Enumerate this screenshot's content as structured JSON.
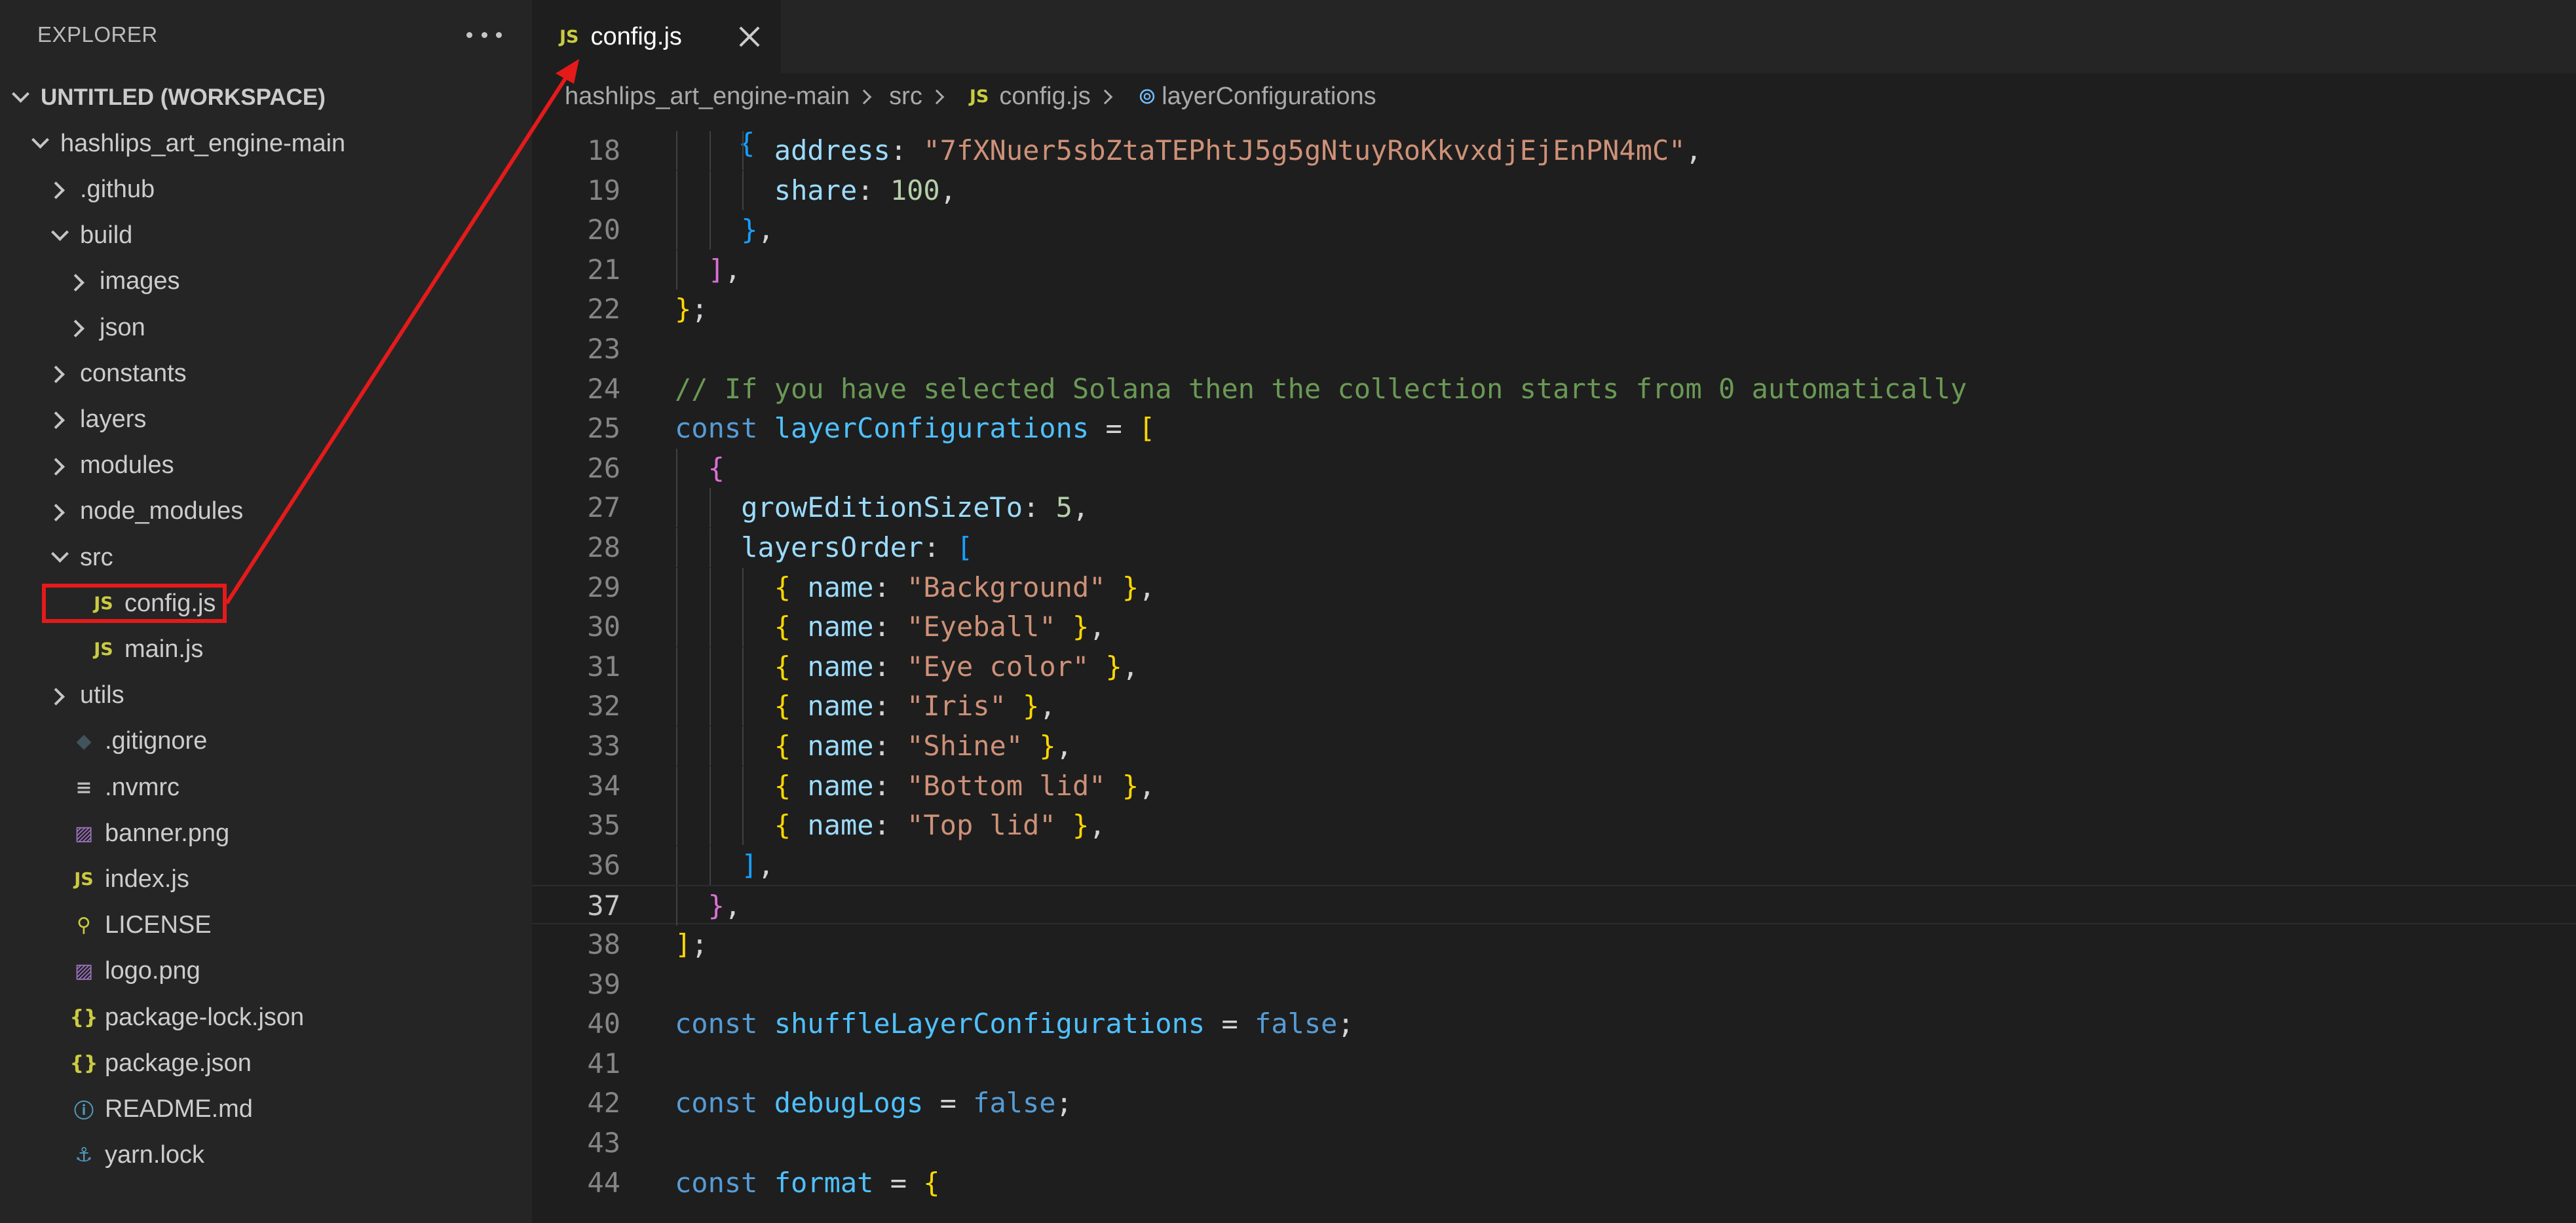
{
  "explorer": {
    "title": "EXPLORER",
    "more_icon": "ellipsis-icon"
  },
  "tree": [
    {
      "label": "UNTITLED (WORKSPACE)",
      "kind": "folder-open",
      "depth": 0,
      "bold": true
    },
    {
      "label": "hashlips_art_engine-main",
      "kind": "folder-open",
      "depth": 1
    },
    {
      "label": ".github",
      "kind": "folder",
      "depth": 2
    },
    {
      "label": "build",
      "kind": "folder-open",
      "depth": 2
    },
    {
      "label": "images",
      "kind": "folder",
      "depth": 3
    },
    {
      "label": "json",
      "kind": "folder",
      "depth": 3
    },
    {
      "label": "constants",
      "kind": "folder",
      "depth": 2
    },
    {
      "label": "layers",
      "kind": "folder",
      "depth": 2
    },
    {
      "label": "modules",
      "kind": "folder",
      "depth": 2
    },
    {
      "label": "node_modules",
      "kind": "folder",
      "depth": 2
    },
    {
      "label": "src",
      "kind": "folder-open",
      "depth": 2
    },
    {
      "label": "config.js",
      "kind": "js",
      "depth": 3,
      "icon_text": "JS",
      "selected": true
    },
    {
      "label": "main.js",
      "kind": "js",
      "depth": 3,
      "icon_text": "JS"
    },
    {
      "label": "utils",
      "kind": "folder",
      "depth": 2
    },
    {
      "label": ".gitignore",
      "kind": "git",
      "depth": 2,
      "icon_text": "◆"
    },
    {
      "label": ".nvmrc",
      "kind": "plain",
      "depth": 2,
      "icon_text": "≡"
    },
    {
      "label": "banner.png",
      "kind": "img",
      "depth": 2,
      "icon_text": "▨"
    },
    {
      "label": "index.js",
      "kind": "js",
      "depth": 2,
      "icon_text": "JS"
    },
    {
      "label": "LICENSE",
      "kind": "lic",
      "depth": 2,
      "icon_text": "⚲"
    },
    {
      "label": "logo.png",
      "kind": "img",
      "depth": 2,
      "icon_text": "▨"
    },
    {
      "label": "package-lock.json",
      "kind": "json",
      "depth": 2,
      "icon_text": "{}"
    },
    {
      "label": "package.json",
      "kind": "json",
      "depth": 2,
      "icon_text": "{}"
    },
    {
      "label": "README.md",
      "kind": "info",
      "depth": 2,
      "icon_text": "ⓘ"
    },
    {
      "label": "yarn.lock",
      "kind": "yarn",
      "depth": 2,
      "icon_text": "⚓"
    }
  ],
  "tab": {
    "badge": "JS",
    "label": "config.js"
  },
  "breadcrumb": {
    "items": [
      "hashlips_art_engine-main",
      "src",
      "config.js",
      "layerConfigurations"
    ],
    "js_badge": "JS",
    "symbol_glyph": "⊚"
  },
  "code": {
    "current_line": 37,
    "lines": [
      {
        "n": "18",
        "indent": 3,
        "tokens": [
          [
            "v",
            "address"
          ],
          [
            "p",
            ": "
          ],
          [
            "s",
            "\"7fXNuer5sbZtaTEPhtJ5g5gNtuyRoKkvxdjEjEnPN4mC\""
          ],
          [
            "p",
            ","
          ]
        ]
      },
      {
        "n": "19",
        "indent": 3,
        "tokens": [
          [
            "v",
            "share"
          ],
          [
            "p",
            ": "
          ],
          [
            "num",
            "100"
          ],
          [
            "p",
            ","
          ]
        ]
      },
      {
        "n": "20",
        "indent": 2,
        "tokens": [
          [
            "b3",
            "}"
          ],
          [
            "p",
            ","
          ]
        ]
      },
      {
        "n": "21",
        "indent": 1,
        "tokens": [
          [
            "b2",
            "]"
          ],
          [
            "p",
            ","
          ]
        ]
      },
      {
        "n": "22",
        "indent": 0,
        "tokens": [
          [
            "b1",
            "}"
          ],
          [
            "p",
            ";"
          ]
        ]
      },
      {
        "n": "23",
        "indent": 0,
        "tokens": []
      },
      {
        "n": "24",
        "indent": 0,
        "tokens": [
          [
            "c",
            "// If you have selected Solana then the collection starts from 0 automatically"
          ]
        ]
      },
      {
        "n": "25",
        "indent": 0,
        "tokens": [
          [
            "k",
            "const "
          ],
          [
            "n",
            "layerConfigurations"
          ],
          [
            "p",
            " = "
          ],
          [
            "b1",
            "["
          ]
        ]
      },
      {
        "n": "26",
        "indent": 1,
        "tokens": [
          [
            "b2",
            "{"
          ]
        ]
      },
      {
        "n": "27",
        "indent": 2,
        "tokens": [
          [
            "v",
            "growEditionSizeTo"
          ],
          [
            "p",
            ": "
          ],
          [
            "num",
            "5"
          ],
          [
            "p",
            ","
          ]
        ]
      },
      {
        "n": "28",
        "indent": 2,
        "tokens": [
          [
            "v",
            "layersOrder"
          ],
          [
            "p",
            ": "
          ],
          [
            "b3",
            "["
          ]
        ]
      },
      {
        "n": "29",
        "indent": 3,
        "tokens": [
          [
            "b1",
            "{ "
          ],
          [
            "v",
            "name"
          ],
          [
            "p",
            ": "
          ],
          [
            "s",
            "\"Background\""
          ],
          [
            "b1",
            " }"
          ],
          [
            "p",
            ","
          ]
        ]
      },
      {
        "n": "30",
        "indent": 3,
        "tokens": [
          [
            "b1",
            "{ "
          ],
          [
            "v",
            "name"
          ],
          [
            "p",
            ": "
          ],
          [
            "s",
            "\"Eyeball\""
          ],
          [
            "b1",
            " }"
          ],
          [
            "p",
            ","
          ]
        ]
      },
      {
        "n": "31",
        "indent": 3,
        "tokens": [
          [
            "b1",
            "{ "
          ],
          [
            "v",
            "name"
          ],
          [
            "p",
            ": "
          ],
          [
            "s",
            "\"Eye color\""
          ],
          [
            "b1",
            " }"
          ],
          [
            "p",
            ","
          ]
        ]
      },
      {
        "n": "32",
        "indent": 3,
        "tokens": [
          [
            "b1",
            "{ "
          ],
          [
            "v",
            "name"
          ],
          [
            "p",
            ": "
          ],
          [
            "s",
            "\"Iris\""
          ],
          [
            "b1",
            " }"
          ],
          [
            "p",
            ","
          ]
        ]
      },
      {
        "n": "33",
        "indent": 3,
        "tokens": [
          [
            "b1",
            "{ "
          ],
          [
            "v",
            "name"
          ],
          [
            "p",
            ": "
          ],
          [
            "s",
            "\"Shine\""
          ],
          [
            "b1",
            " }"
          ],
          [
            "p",
            ","
          ]
        ]
      },
      {
        "n": "34",
        "indent": 3,
        "tokens": [
          [
            "b1",
            "{ "
          ],
          [
            "v",
            "name"
          ],
          [
            "p",
            ": "
          ],
          [
            "s",
            "\"Bottom lid\""
          ],
          [
            "b1",
            " }"
          ],
          [
            "p",
            ","
          ]
        ]
      },
      {
        "n": "35",
        "indent": 3,
        "tokens": [
          [
            "b1",
            "{ "
          ],
          [
            "v",
            "name"
          ],
          [
            "p",
            ": "
          ],
          [
            "s",
            "\"Top lid\""
          ],
          [
            "b1",
            " }"
          ],
          [
            "p",
            ","
          ]
        ]
      },
      {
        "n": "36",
        "indent": 2,
        "tokens": [
          [
            "b3",
            "]"
          ],
          [
            "p",
            ","
          ]
        ]
      },
      {
        "n": "37",
        "indent": 1,
        "tokens": [
          [
            "b2",
            "}"
          ],
          [
            "p",
            ","
          ]
        ]
      },
      {
        "n": "38",
        "indent": 0,
        "tokens": [
          [
            "b1",
            "]"
          ],
          [
            "p",
            ";"
          ]
        ]
      },
      {
        "n": "39",
        "indent": 0,
        "tokens": []
      },
      {
        "n": "40",
        "indent": 0,
        "tokens": [
          [
            "k",
            "const "
          ],
          [
            "n",
            "shuffleLayerConfigurations"
          ],
          [
            "p",
            " = "
          ],
          [
            "k",
            "false"
          ],
          [
            "p",
            ";"
          ]
        ]
      },
      {
        "n": "41",
        "indent": 0,
        "tokens": []
      },
      {
        "n": "42",
        "indent": 0,
        "tokens": [
          [
            "k",
            "const "
          ],
          [
            "n",
            "debugLogs"
          ],
          [
            "p",
            " = "
          ],
          [
            "k",
            "false"
          ],
          [
            "p",
            ";"
          ]
        ]
      },
      {
        "n": "43",
        "indent": 0,
        "tokens": []
      },
      {
        "n": "44",
        "indent": 0,
        "tokens": [
          [
            "k",
            "const "
          ],
          [
            "n",
            "format"
          ],
          [
            "p",
            " = "
          ],
          [
            "b1",
            "{"
          ]
        ]
      }
    ]
  },
  "annotation": {
    "color": "#e51a1a"
  }
}
